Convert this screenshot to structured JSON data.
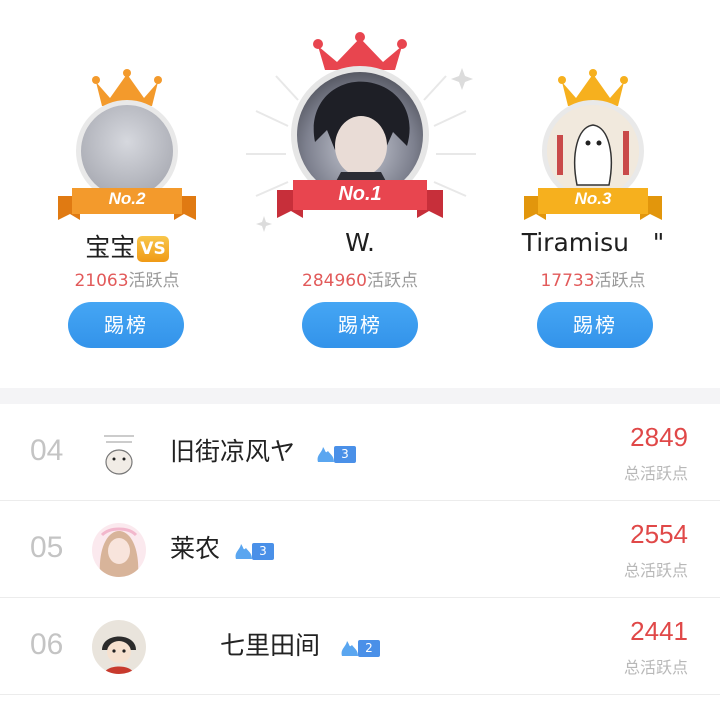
{
  "top3": [
    {
      "rank_label": "No.2",
      "name": "宝宝",
      "badge": "VS",
      "score": "21063",
      "score_suffix": "活跃点",
      "button": "踢榜"
    },
    {
      "rank_label": "No.1",
      "name": "W.",
      "score": "284960",
      "score_suffix": "活跃点",
      "button": "踢榜"
    },
    {
      "rank_label": "No.3",
      "name": "Tiramisu   \"",
      "score": "17733",
      "score_suffix": "活跃点",
      "button": "踢榜"
    }
  ],
  "list": [
    {
      "rank": "04",
      "name": "旧街凉风ヤ",
      "level": "3",
      "score": "2849",
      "score_label": "总活跃点"
    },
    {
      "rank": "05",
      "name": "莱农",
      "level": "3",
      "score": "2554",
      "score_label": "总活跃点"
    },
    {
      "rank": "06",
      "name": "七里田间",
      "level": "2",
      "score": "2441",
      "score_label": "总活跃点"
    }
  ],
  "colors": {
    "accent_blue": "#3a99ee",
    "score_red": "#e04848",
    "gold": "#f6b01e",
    "orange": "#f39a2c",
    "red": "#e8454f"
  }
}
